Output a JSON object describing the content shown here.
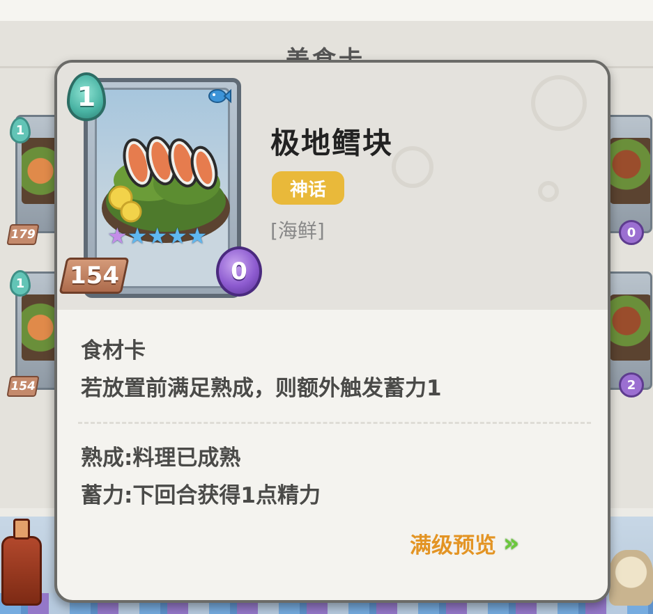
{
  "background": {
    "partial_title": "美食卡"
  },
  "side_cards": [
    {
      "cost": "1",
      "value": "179"
    },
    {
      "cost": "1",
      "value": "154"
    },
    {
      "energy": "0"
    },
    {
      "energy": "2"
    }
  ],
  "tooltip": {
    "card": {
      "cost": "1",
      "value": "154",
      "energy": "0",
      "stars": {
        "filled_purple": 1,
        "filled_blue": 4
      },
      "category_icon": "fish-icon"
    },
    "name": "极地鳕块",
    "rarity": "神话",
    "category": "[海鲜]",
    "type": "食材卡",
    "effect": "若放置前满足熟成，则额外触发蓄力1",
    "keywords": [
      "熟成:料理已成熟",
      "蓄力:下回合获得1点精力"
    ],
    "preview_label": "满级预览"
  },
  "colors": {
    "rarity_badge": "#e9b93a",
    "preview_label": "#e39424",
    "preview_arrow": "#6bc93a",
    "cost_gem": "#49b3a3",
    "energy_orb": "#8d5bd0"
  }
}
